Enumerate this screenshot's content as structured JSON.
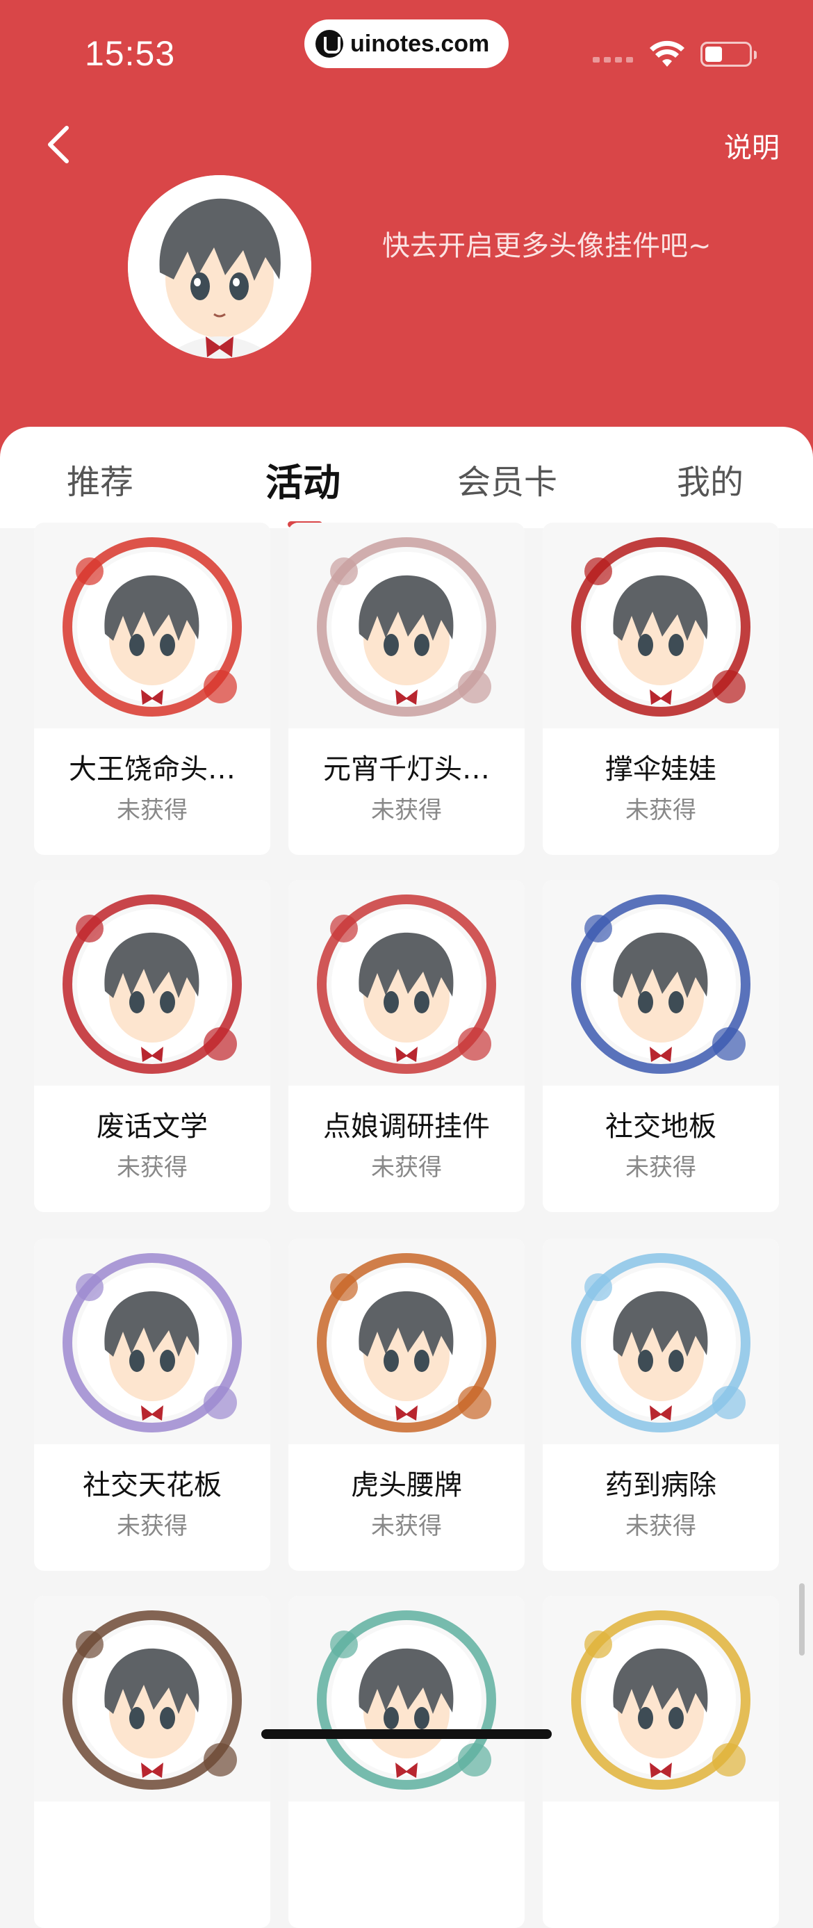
{
  "status_bar": {
    "time": "15:53",
    "url": "uinotes.com"
  },
  "header": {
    "help_label": "说明",
    "promo_text": "快去开启更多头像挂件吧~"
  },
  "tabs": [
    {
      "label": "推荐",
      "active": false
    },
    {
      "label": "活动",
      "active": true
    },
    {
      "label": "会员卡",
      "active": false
    },
    {
      "label": "我的",
      "active": false
    }
  ],
  "colors": {
    "brand_red": "#d94648",
    "text_dark": "#111111",
    "text_muted": "#888888"
  },
  "pendants": [
    {
      "name": "大王饶命头…",
      "status": "未获得",
      "icon": "fox-spirit-frame-icon"
    },
    {
      "name": "元宵千灯头…",
      "status": "未获得",
      "icon": "lantern-frame-icon"
    },
    {
      "name": "撑伞娃娃",
      "status": "未获得",
      "icon": "umbrella-doll-frame-icon"
    },
    {
      "name": "废话文学",
      "status": "未获得",
      "icon": "nonsense-literature-frame-icon"
    },
    {
      "name": "点娘调研挂件",
      "status": "未获得",
      "icon": "survey-girl-frame-icon"
    },
    {
      "name": "社交地板",
      "status": "未获得",
      "icon": "snorkel-frame-icon"
    },
    {
      "name": "社交天花板",
      "status": "未获得",
      "icon": "speech-bubble-frame-icon"
    },
    {
      "name": "虎头腰牌",
      "status": "未获得",
      "icon": "tiger-badge-frame-icon"
    },
    {
      "name": "药到病除",
      "status": "未获得",
      "icon": "pill-frame-icon"
    },
    {
      "name": "",
      "status": "",
      "icon": "ice-cream-frame-icon"
    },
    {
      "name": "",
      "status": "",
      "icon": "cloud-dragon-frame-icon"
    },
    {
      "name": "",
      "status": "",
      "icon": "gold-coin-frame-icon"
    }
  ]
}
